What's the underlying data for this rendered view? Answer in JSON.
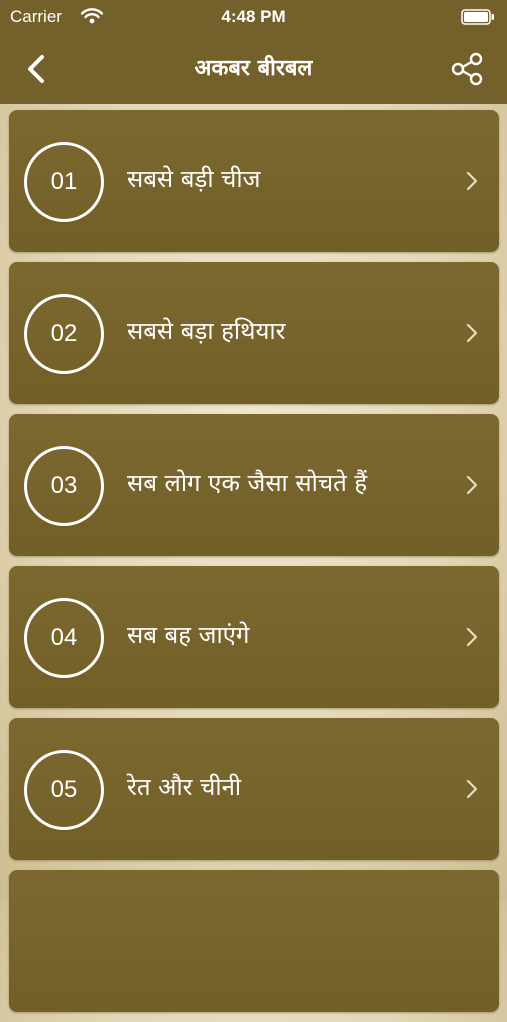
{
  "status_bar": {
    "carrier": "Carrier",
    "time": "4:48 PM"
  },
  "nav": {
    "title": "अकबर बीरबल",
    "back_icon": "chevron-left-icon",
    "share_icon": "share-icon"
  },
  "list": {
    "items": [
      {
        "number": "01",
        "title": "सबसे बड़ी चीज"
      },
      {
        "number": "02",
        "title": "सबसे बड़ा हथियार"
      },
      {
        "number": "03",
        "title": "सब लोग एक जैसा सोचते हैं"
      },
      {
        "number": "04",
        "title": "सब बह जाएंगे"
      },
      {
        "number": "05",
        "title": "रेत और चीनी"
      }
    ]
  },
  "colors": {
    "header": "#74602a",
    "row": "#776429",
    "background": "#e3d7b5",
    "text": "#ffffff"
  }
}
